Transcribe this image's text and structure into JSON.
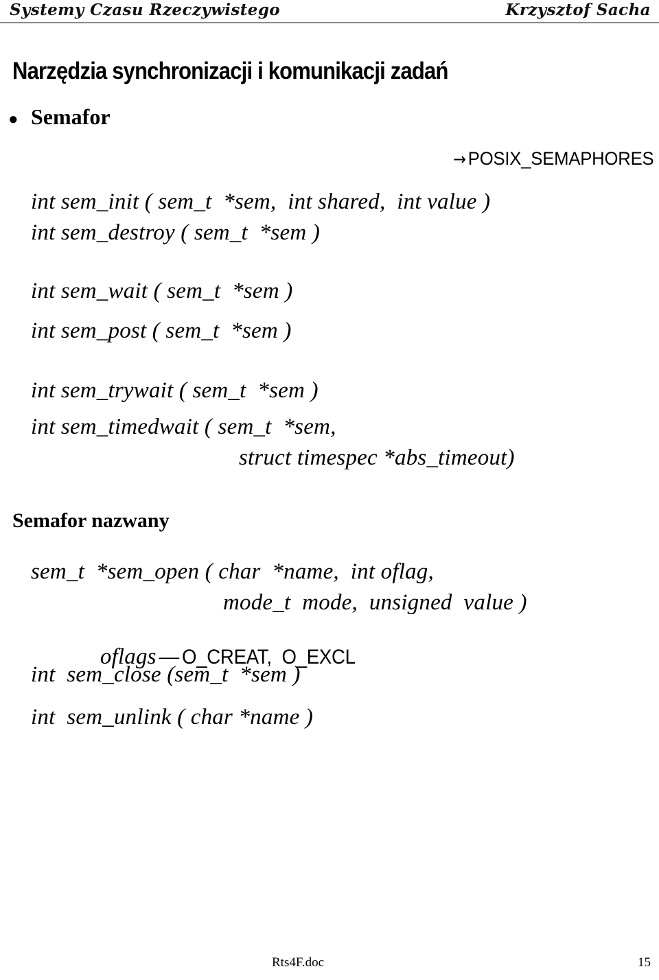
{
  "header": {
    "left": "Systemy Czasu Rzeczywistego",
    "right": "Krzysztof Sacha"
  },
  "title": "Narzędzia synchronizacji i komunikacji zadań",
  "sections": [
    {
      "heading": "Semafor",
      "bulleted": true,
      "note": {
        "arrow": "→",
        "text": "POSIX_SEMAPHORES"
      }
    },
    {
      "heading": "Semafor nazwany",
      "bulleted": false
    }
  ],
  "code": {
    "unnamed_semaphore": [
      "int sem_init ( sem_t  *sem,  int shared,  int value )",
      "int sem_destroy ( sem_t  *sem )",
      "int sem_wait ( sem_t  *sem )",
      "int sem_post ( sem_t  *sem )",
      "int sem_trywait ( sem_t  *sem )",
      "int sem_timedwait ( sem_t  *sem,",
      "struct timespec *abs_timeout)"
    ],
    "named_semaphore": [
      "sem_t  *sem_open ( char  *name,  int oflag,",
      "mode_t  mode,  unsigned  value )",
      "int  sem_close (sem_t  *sem )",
      "int  sem_unlink ( char *name )"
    ],
    "oflags_note": {
      "label": "oflags",
      "dash": "—",
      "values": "O_CREAT,  O_EXCL"
    }
  },
  "footer": {
    "file": "Rts4F.doc",
    "page": "15"
  }
}
